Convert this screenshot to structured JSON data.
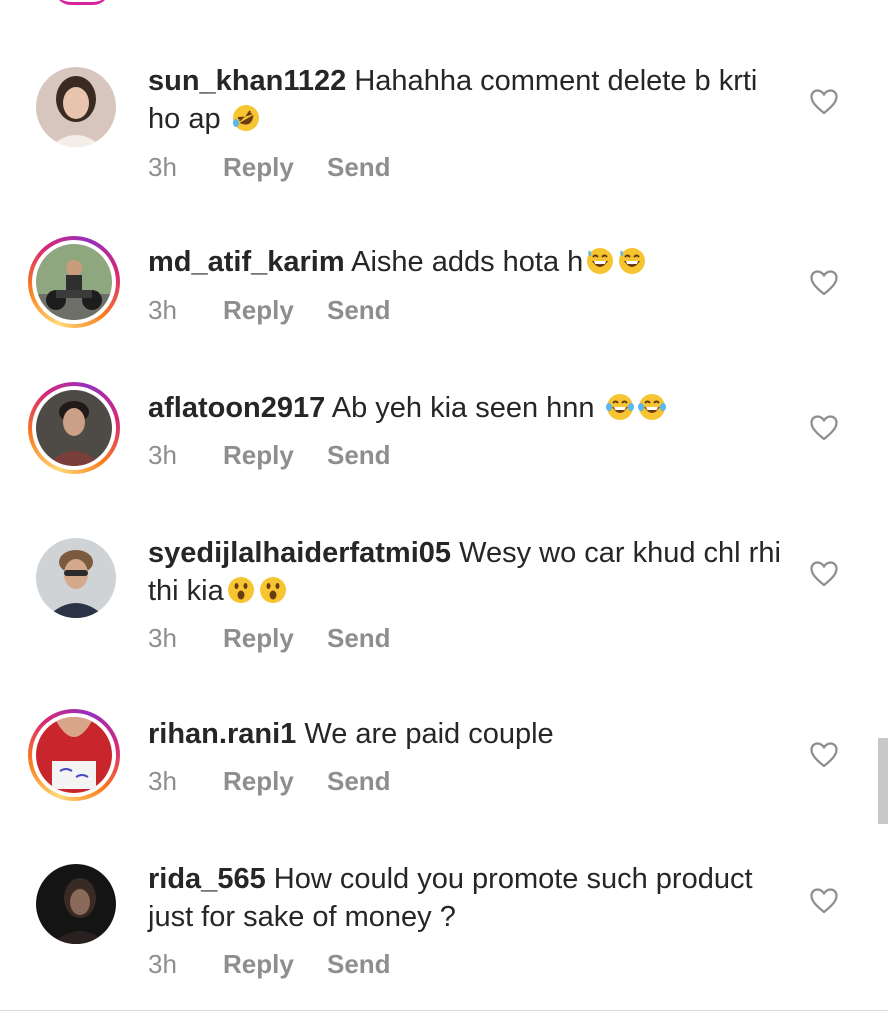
{
  "comments": [
    {
      "username": "sun_khan1122",
      "text": "Hahahha comment delete b krti ho  ap",
      "emojis": [
        "rolling-on-floor-laughing"
      ],
      "time": "3h",
      "reply_label": "Reply",
      "send_label": "Send",
      "has_story_ring": false
    },
    {
      "username": "md_atif_karim",
      "text": "Aishe adds hota h",
      "emojis": [
        "grinning-sweat",
        "grinning-sweat"
      ],
      "time": "3h",
      "reply_label": "Reply",
      "send_label": "Send",
      "has_story_ring": true
    },
    {
      "username": "aflatoon2917",
      "text": "Ab yeh kia seen hnn",
      "emojis": [
        "tears-of-joy",
        "tears-of-joy"
      ],
      "time": "3h",
      "reply_label": "Reply",
      "send_label": "Send",
      "has_story_ring": true
    },
    {
      "username": "syedijlalhaiderfatmi05",
      "text": "Wesy wo car khud chl rhi thi kia",
      "emojis": [
        "astonished",
        "astonished"
      ],
      "time": "3h",
      "reply_label": "Reply",
      "send_label": "Send",
      "has_story_ring": false
    },
    {
      "username": "rihan.rani1",
      "text": "We are paid couple",
      "emojis": [],
      "time": "3h",
      "reply_label": "Reply",
      "send_label": "Send",
      "has_story_ring": true
    },
    {
      "username": "rida_565",
      "text": "How could you promote such product just for  sake of  money ?",
      "emojis": [],
      "time": "3h",
      "reply_label": "Reply",
      "send_label": "Send",
      "has_story_ring": false
    }
  ],
  "icons": {
    "like": "heart-outline-icon"
  },
  "colors": {
    "text": "#262626",
    "secondary": "#8e8e8e",
    "story_ring": "#d62976"
  }
}
